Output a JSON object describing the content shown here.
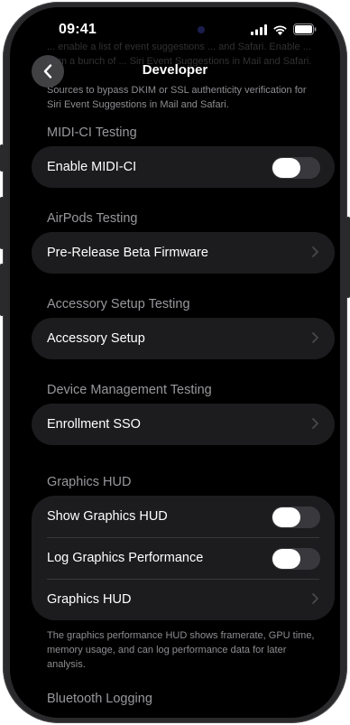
{
  "status_bar": {
    "time": "09:41"
  },
  "nav": {
    "title": "Developer"
  },
  "intro_text_faded": "... enable a list of event suggestions ... and Safari. Enable ... from a bunch of ... Siri Event Suggestions in Mail and Safari.",
  "intro_text": "Sources to bypass DKIM or SSL authenticity verification for Siri Event Suggestions in Mail and Safari.",
  "sections": {
    "midi": {
      "title": "MIDI-CI Testing",
      "rows": [
        {
          "label": "Enable MIDI-CI",
          "control": "toggle",
          "on": false
        }
      ]
    },
    "airpods": {
      "title": "AirPods Testing",
      "rows": [
        {
          "label": "Pre-Release Beta Firmware",
          "control": "chevron"
        }
      ]
    },
    "accessory": {
      "title": "Accessory Setup Testing",
      "rows": [
        {
          "label": "Accessory Setup",
          "control": "chevron"
        }
      ]
    },
    "device_mgmt": {
      "title": "Device Management Testing",
      "rows": [
        {
          "label": "Enrollment SSO",
          "control": "chevron"
        }
      ]
    },
    "graphics": {
      "title": "Graphics HUD",
      "rows": [
        {
          "label": "Show Graphics HUD",
          "control": "toggle",
          "on": false
        },
        {
          "label": "Log Graphics Performance",
          "control": "toggle",
          "on": false
        },
        {
          "label": "Graphics HUD",
          "control": "chevron"
        }
      ],
      "footnote": "The graphics performance HUD shows framerate, GPU time, memory usage, and can log performance data for later analysis."
    },
    "bluetooth": {
      "title": "Bluetooth Logging"
    }
  },
  "colors": {
    "background": "#000000",
    "card": "#1c1c1e",
    "secondary_text": "#98989d",
    "toggle_off": "#39393d"
  },
  "icons": [
    "back-chevron-icon",
    "cellular-signal-icon",
    "wifi-icon",
    "battery-icon",
    "chevron-right-icon"
  ]
}
